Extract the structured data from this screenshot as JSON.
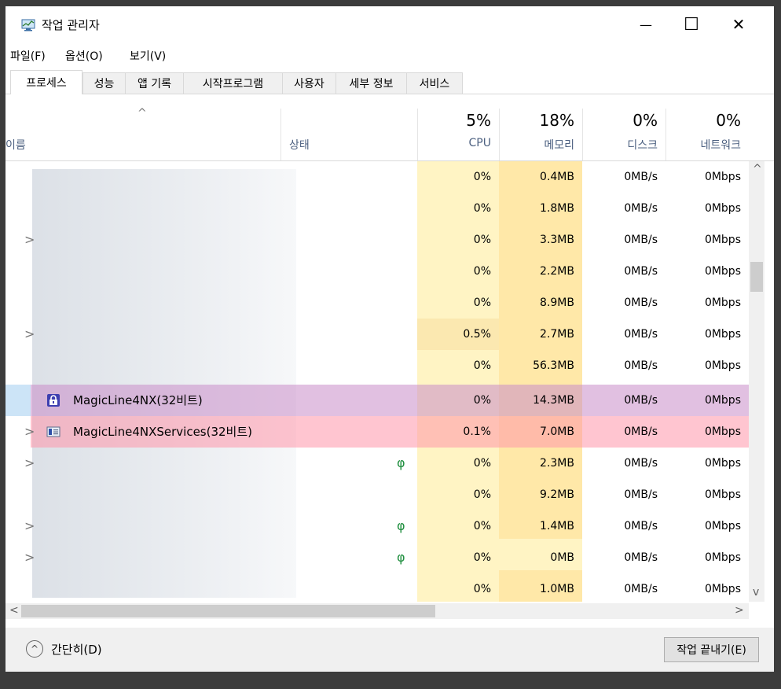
{
  "window": {
    "title": "작업 관리자",
    "minimize_glyph": "—",
    "maximize_glyph": "☐",
    "close_glyph": "✕"
  },
  "menu": [
    "파일(F)",
    "옵션(O)",
    "보기(V)"
  ],
  "tabs": [
    "프로세스",
    "성능",
    "앱 기록",
    "시작프로그램",
    "사용자",
    "세부 정보",
    "서비스"
  ],
  "header": {
    "sort_glyph": "^",
    "name": "이름",
    "status": "상태",
    "cpu_pct": "5%",
    "cpu": "CPU",
    "mem_pct": "18%",
    "mem": "메모리",
    "disk_pct": "0%",
    "disk": "디스크",
    "net_pct": "0%",
    "net": "네트워크"
  },
  "rows": [
    {
      "name": "",
      "expand": "",
      "leaf": "",
      "cpu": "0%",
      "mem": "0.4MB",
      "disk": "0MB/s",
      "net": "0Mbps"
    },
    {
      "name": "",
      "expand": "",
      "leaf": "",
      "cpu": "0%",
      "mem": "1.8MB",
      "disk": "0MB/s",
      "net": "0Mbps"
    },
    {
      "name": "",
      "expand": ">",
      "leaf": "",
      "cpu": "0%",
      "mem": "3.3MB",
      "disk": "0MB/s",
      "net": "0Mbps"
    },
    {
      "name": "",
      "expand": "",
      "leaf": "",
      "cpu": "0%",
      "mem": "2.2MB",
      "disk": "0MB/s",
      "net": "0Mbps"
    },
    {
      "name": "",
      "expand": "",
      "leaf": "",
      "cpu": "0%",
      "mem": "8.9MB",
      "disk": "0MB/s",
      "net": "0Mbps"
    },
    {
      "name": "",
      "expand": ">",
      "leaf": "",
      "cpu": "0.5%",
      "mem": "2.7MB",
      "disk": "0MB/s",
      "net": "0Mbps"
    },
    {
      "name": "",
      "expand": "",
      "leaf": "",
      "cpu": "0%",
      "mem": "56.3MB",
      "disk": "0MB/s",
      "net": "0Mbps"
    },
    {
      "name": "MagicLine4NX(32비트)",
      "expand": "",
      "leaf": "",
      "cpu": "0%",
      "mem": "14.3MB",
      "disk": "0MB/s",
      "net": "0Mbps"
    },
    {
      "name": "MagicLine4NXServices(32비트)",
      "expand": ">",
      "leaf": "",
      "cpu": "0.1%",
      "mem": "7.0MB",
      "disk": "0MB/s",
      "net": "0Mbps"
    },
    {
      "name": "",
      "expand": ">",
      "leaf": "φ",
      "cpu": "0%",
      "mem": "2.3MB",
      "disk": "0MB/s",
      "net": "0Mbps"
    },
    {
      "name": "",
      "expand": "",
      "leaf": "",
      "cpu": "0%",
      "mem": "9.2MB",
      "disk": "0MB/s",
      "net": "0Mbps"
    },
    {
      "name": "",
      "expand": ">",
      "leaf": "φ",
      "cpu": "0%",
      "mem": "1.4MB",
      "disk": "0MB/s",
      "net": "0Mbps"
    },
    {
      "name": "",
      "expand": ">",
      "leaf": "φ",
      "cpu": "0%",
      "mem": "0MB",
      "disk": "0MB/s",
      "net": "0Mbps"
    },
    {
      "name": "",
      "expand": "",
      "leaf": "",
      "cpu": "0%",
      "mem": "1.0MB",
      "disk": "0MB/s",
      "net": "0Mbps"
    }
  ],
  "scroll": {
    "up": "^",
    "down": "v",
    "left": "<",
    "right": ">"
  },
  "footer": {
    "fewer_details": "간단히(D)",
    "fewer_glyph": "^",
    "end_task": "작업 끝내기(E)"
  },
  "colors": {
    "highlight_pink": "#ffb6c1",
    "selected_purple": "#c8a8d8",
    "cpu_bg": "#fff4c4",
    "mem_bg": "#ffe8a8"
  }
}
